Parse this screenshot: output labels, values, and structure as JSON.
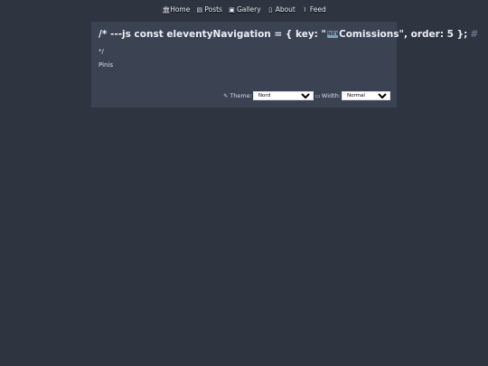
{
  "nav": {
    "items": [
      {
        "label": "Home",
        "icon": "home-icon"
      },
      {
        "label": "Posts",
        "icon": "posts-icon"
      },
      {
        "label": "Gallery",
        "icon": "gallery-icon"
      },
      {
        "label": "About",
        "icon": "about-icon"
      },
      {
        "label": "Feed",
        "icon": "rss-icon"
      }
    ]
  },
  "article": {
    "title_prefix": "/* ---js const eleventyNavigation = { key: \"",
    "title_suffix": "Comissions\", order: 5 };",
    "title_emoji_icon": "new-button-emoji-icon",
    "anchor": "#",
    "comment_end": "*/",
    "paragraph": "Pinis"
  },
  "controls": {
    "theme_label": "Theme:",
    "theme_value": "Nord",
    "width_label": "Width:",
    "width_value": "Normal"
  },
  "colors": {
    "background": "#2e3440",
    "card": "#3b4252",
    "text": "#eceff4",
    "anchor": "#6b7588"
  }
}
